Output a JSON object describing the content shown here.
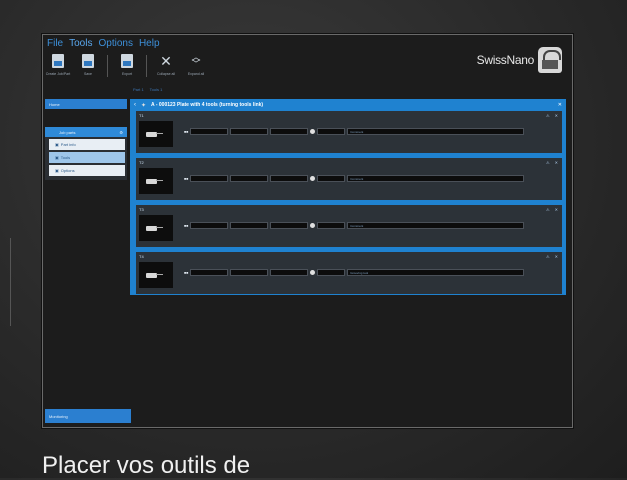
{
  "menu": [
    "File",
    "Tools",
    "Options",
    "Help"
  ],
  "toolbar": {
    "buttons": [
      {
        "label": "Create Job/Part",
        "icon": "document-icon"
      },
      {
        "label": "Save",
        "icon": "save-icon"
      },
      {
        "label": "Export",
        "icon": "export-icon"
      },
      {
        "label": "Collapse all",
        "icon": "collapse-icon"
      },
      {
        "label": "Expand all",
        "icon": "expand-icon"
      }
    ]
  },
  "tabs": [
    "Part 1",
    "Tools 1"
  ],
  "logo": {
    "text": "SwissNano"
  },
  "sidebar": {
    "home": "Home",
    "selected": "Job parts",
    "subitems": [
      "Part info",
      "Tools",
      "Options"
    ],
    "bottom": "Monitoring"
  },
  "panel": {
    "title": "A - 000123 Plate with 4 tools (turning tools link)",
    "tools": [
      {
        "name": "T1",
        "value": "Comment"
      },
      {
        "name": "T2",
        "value": "Comment"
      },
      {
        "name": "T3",
        "value": "Comment"
      },
      {
        "name": "T4",
        "value": "Grooving tool"
      }
    ]
  },
  "caption": "Placer vos outils de",
  "colors": {
    "accent": "#1f82d0",
    "menu": "#3d8fd8",
    "background": "#2a2a2a"
  }
}
